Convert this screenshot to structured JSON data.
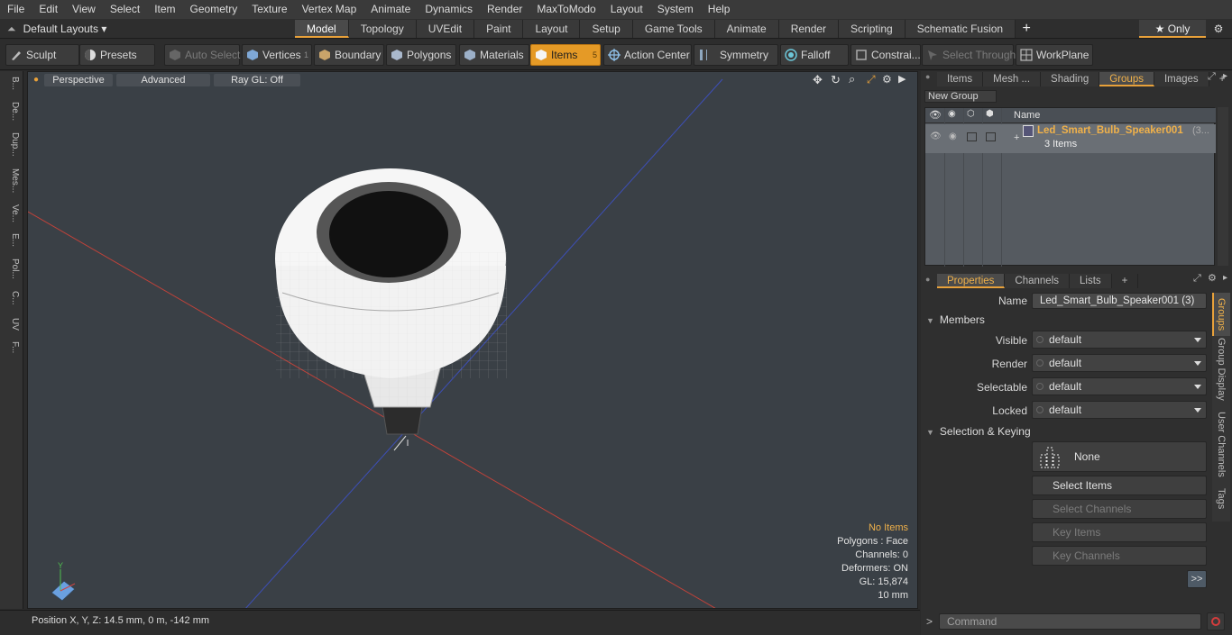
{
  "menu": [
    "File",
    "Edit",
    "View",
    "Select",
    "Item",
    "Geometry",
    "Texture",
    "Vertex Map",
    "Animate",
    "Dynamics",
    "Render",
    "MaxToModo",
    "Layout",
    "System",
    "Help"
  ],
  "layouts": {
    "label": "Default Layouts ▾"
  },
  "main_tabs": [
    {
      "label": "Model",
      "active": true
    },
    {
      "label": "Topology"
    },
    {
      "label": "UVEdit"
    },
    {
      "label": "Paint"
    },
    {
      "label": "Layout"
    },
    {
      "label": "Setup"
    },
    {
      "label": "Game Tools"
    },
    {
      "label": "Animate"
    },
    {
      "label": "Render"
    },
    {
      "label": "Scripting"
    },
    {
      "label": "Schematic Fusion"
    }
  ],
  "only": {
    "label": "★ Only"
  },
  "toolbar": {
    "sculpt": "Sculpt",
    "presets": "Presets",
    "auto_select": "Auto Select",
    "vertices": "Vertices",
    "vertices_count": "1",
    "boundary": "Boundary",
    "polygons": "Polygons",
    "materials": "Materials",
    "items": "Items",
    "items_count": "5",
    "action_center": "Action Center",
    "symmetry": "Symmetry",
    "falloff": "Falloff",
    "constraints": "Constrai...",
    "select_through": "Select Through",
    "workplane": "WorkPlane"
  },
  "left_strip": [
    "B...",
    "De...",
    "Dup...",
    "Mes...",
    "Ve...",
    "E...",
    "Pol...",
    "C...",
    "UV",
    "F..."
  ],
  "viewport": {
    "view": "Perspective",
    "shading": "Advanced",
    "raygl": "Ray GL: Off",
    "hud": {
      "items": "No Items",
      "polygons": "Polygons : Face",
      "channels": "Channels: 0",
      "deformers": "Deformers: ON",
      "gl": "GL: 15,874",
      "scale": "10 mm"
    }
  },
  "status": {
    "position": "Position X, Y, Z:   14.5 mm, 0 m, -142 mm"
  },
  "top_tabs": [
    {
      "label": "Items"
    },
    {
      "label": "Mesh ..."
    },
    {
      "label": "Shading"
    },
    {
      "label": "Groups",
      "active": true
    },
    {
      "label": "Images"
    }
  ],
  "groups": {
    "new_group": "New Group",
    "col_name": "Name",
    "row_name": "Led_Smart_Bulb_Speaker001",
    "row_suffix": "(3...",
    "row_sub": "3 Items"
  },
  "prop_tabs": [
    {
      "label": "Properties",
      "active": true
    },
    {
      "label": "Channels"
    },
    {
      "label": "Lists"
    }
  ],
  "properties": {
    "name_label": "Name",
    "name_value": "Led_Smart_Bulb_Speaker001 (3)",
    "members": "Members",
    "visible_label": "Visible",
    "visible": "default",
    "render_label": "Render",
    "render": "default",
    "selectable_label": "Selectable",
    "selectable": "default",
    "locked_label": "Locked",
    "locked": "default",
    "sel_keying": "Selection & Keying",
    "none": "None",
    "select_items": "Select Items",
    "select_channels": "Select Channels",
    "key_items": "Key Items",
    "key_channels": "Key Channels",
    "more": ">>"
  },
  "side_tabs": [
    {
      "label": "Groups",
      "active": true
    },
    {
      "label": "Group Display"
    },
    {
      "label": "User Channels"
    },
    {
      "label": "Tags"
    }
  ],
  "command": {
    "prompt": ">",
    "placeholder": "Command"
  },
  "colors": {
    "accent": "#e8a13a",
    "item_highlight": "#f0b14a",
    "viewport_bg": "#3a4046"
  }
}
